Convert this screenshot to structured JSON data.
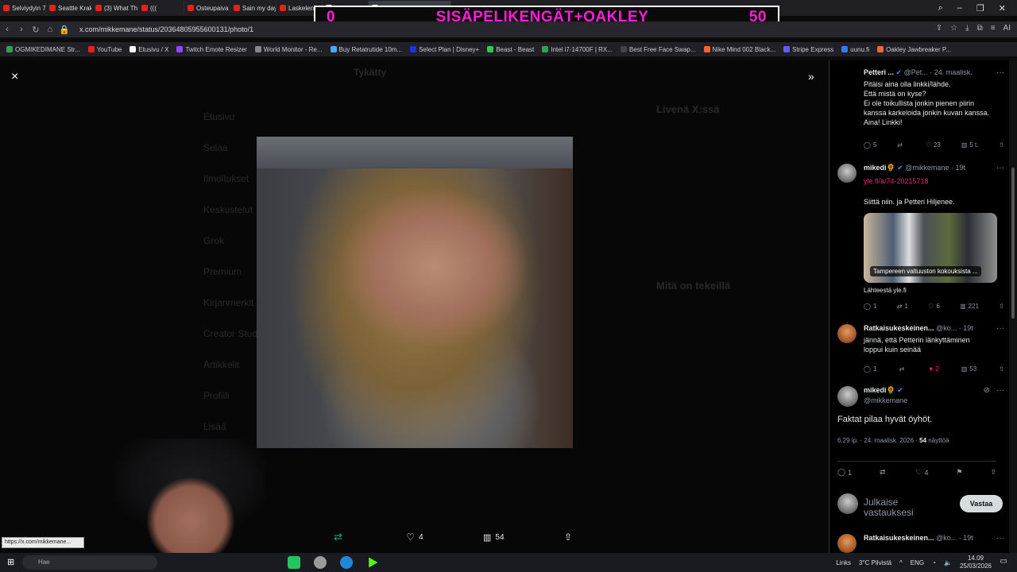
{
  "browser": {
    "tabs": [
      {
        "label": "Selviydyin 7 päivää maailm",
        "color": "#e62117"
      },
      {
        "label": "Seattle Kraken at Florida P",
        "color": "#e62117"
      },
      {
        "label": "(3) What This Streamer Did",
        "color": "#e62117"
      },
      {
        "label": "(((",
        "color": "#e62117"
      },
      {
        "label": "Osteupaiva IPC - YouTube",
        "color": "#e62117"
      },
      {
        "label": "Sain my day 24.3 - som",
        "color": "#e62117"
      },
      {
        "label": "Laskelen jakso 8 Showpir",
        "color": "#e62117"
      },
      {
        "label": "Etusivu / X",
        "color": "#ffffff"
      },
      {
        "label": "Tykkäyt / X",
        "color": "#ffffff",
        "active": true
      }
    ],
    "new_tab": "+",
    "url": "x.com/mikkemane/status/2036480595560013​1/photo/1",
    "ai_label": "AI",
    "bookmarks": [
      {
        "label": "OGMIKEDIMANE Str...",
        "color": "#2da44e"
      },
      {
        "label": "YouTube",
        "color": "#e62117"
      },
      {
        "label": "Etusivu / X",
        "color": "#ffffff"
      },
      {
        "label": "Twitch Emote Resizer",
        "color": "#9146ff"
      },
      {
        "label": "World Monitor - Re...",
        "color": "#888888"
      },
      {
        "label": "Buy Retatrutide 10m...",
        "color": "#44aaff"
      },
      {
        "label": "Select Plan | Disney+",
        "color": "#113ccf"
      },
      {
        "label": "Beast - Beast",
        "color": "#31c94b"
      },
      {
        "label": "Intel i7-14700F | RX...",
        "color": "#2da44e"
      },
      {
        "label": "Best Free Face Swap...",
        "color": "#444444"
      },
      {
        "label": "Nike Mind 002 Black...",
        "color": "#ff6633"
      },
      {
        "label": "Stripe Express",
        "color": "#635bff"
      },
      {
        "label": "uunu.fi",
        "color": "#2f7cf6"
      },
      {
        "label": "Oakley Jawbreaker P...",
        "color": "#ff6633"
      }
    ]
  },
  "overlay": {
    "left": "0",
    "title": "SISÄPELIKENGÄT+OAKLEY",
    "right": "50"
  },
  "background_page": {
    "sidebar": [
      "Etusivu",
      "Selaa",
      "Ilmoitukset",
      "Keskustelut",
      "Grok",
      "Premium",
      "Kirjanmerkit",
      "Creator Studio",
      "Artikkelit",
      "Profiili",
      "Lisää"
    ],
    "title": "Tykätty",
    "right_title": "Livenä X:ssä",
    "right_title2": "Mitä on tekeillä"
  },
  "viewer": {
    "close": "×",
    "expand": "»",
    "actions": {
      "retweets": "",
      "likes": "4",
      "views": "54"
    }
  },
  "url_hint": "https://x.com/mikkemane...",
  "right_panel": {
    "reply1": {
      "name": "Petteri ...",
      "handle": "@Pet...",
      "time": "· 24. maalisk.",
      "lines": [
        "Pitäisi aina olla linkki/lähde.",
        "Että mistä on kyse?",
        "Ei ole toikullista jonkin pienen piirin",
        "kanssa karkeloida jonkin kuvan kanssa.",
        "Aina! Linkki!"
      ],
      "stats": {
        "replies": "5",
        "retweets": "",
        "likes": "23",
        "views": "5 t."
      }
    },
    "reply2": {
      "name": "mikedi🌻",
      "handle": "@mikkemane",
      "time": "· 19t",
      "link": "yle.fi/a/74-20215718",
      "text": "Siittä niin. ja Petteri Hiljenee.",
      "image_caption": "Tampereen valtuuston kokouksista ...",
      "source": "Lähteestä yle.fi",
      "stats": {
        "replies": "1",
        "retweets": "1",
        "likes": "6",
        "views": "221"
      }
    },
    "reply3": {
      "name": "Ratkaisukeskeinen...",
      "handle": "@ko...",
      "time": "· 19t",
      "lines": [
        "jännä, että Petterin länkyttäminen",
        "loppui kuin seinää"
      ],
      "stats": {
        "replies": "1",
        "retweets": "",
        "likes": "2",
        "views": "53"
      }
    },
    "main_post": {
      "name": "mikedi🌻",
      "handle": "@mikkemane",
      "text": "Faktat pilaa hyvät öyhöt.",
      "meta_time": "6.29 ip. · 24. maalisk. 2026 · ",
      "meta_views": "54",
      "meta_views_label": " näyttöä",
      "stats": {
        "replies": "1",
        "retweets": "",
        "likes": "4"
      }
    },
    "compose": {
      "placeholder": "Julkaise vastauksesi",
      "button": "Vastaa"
    },
    "reply4": {
      "name": "Ratkaisukeskeinen...",
      "handle": "@ko...",
      "time": "· 19t"
    }
  },
  "taskbar": {
    "search": "Hae",
    "weather": "3°C Pilvistä",
    "links": "Links",
    "lang": "ENG",
    "time": "14.09",
    "date": "25/03/2026"
  }
}
